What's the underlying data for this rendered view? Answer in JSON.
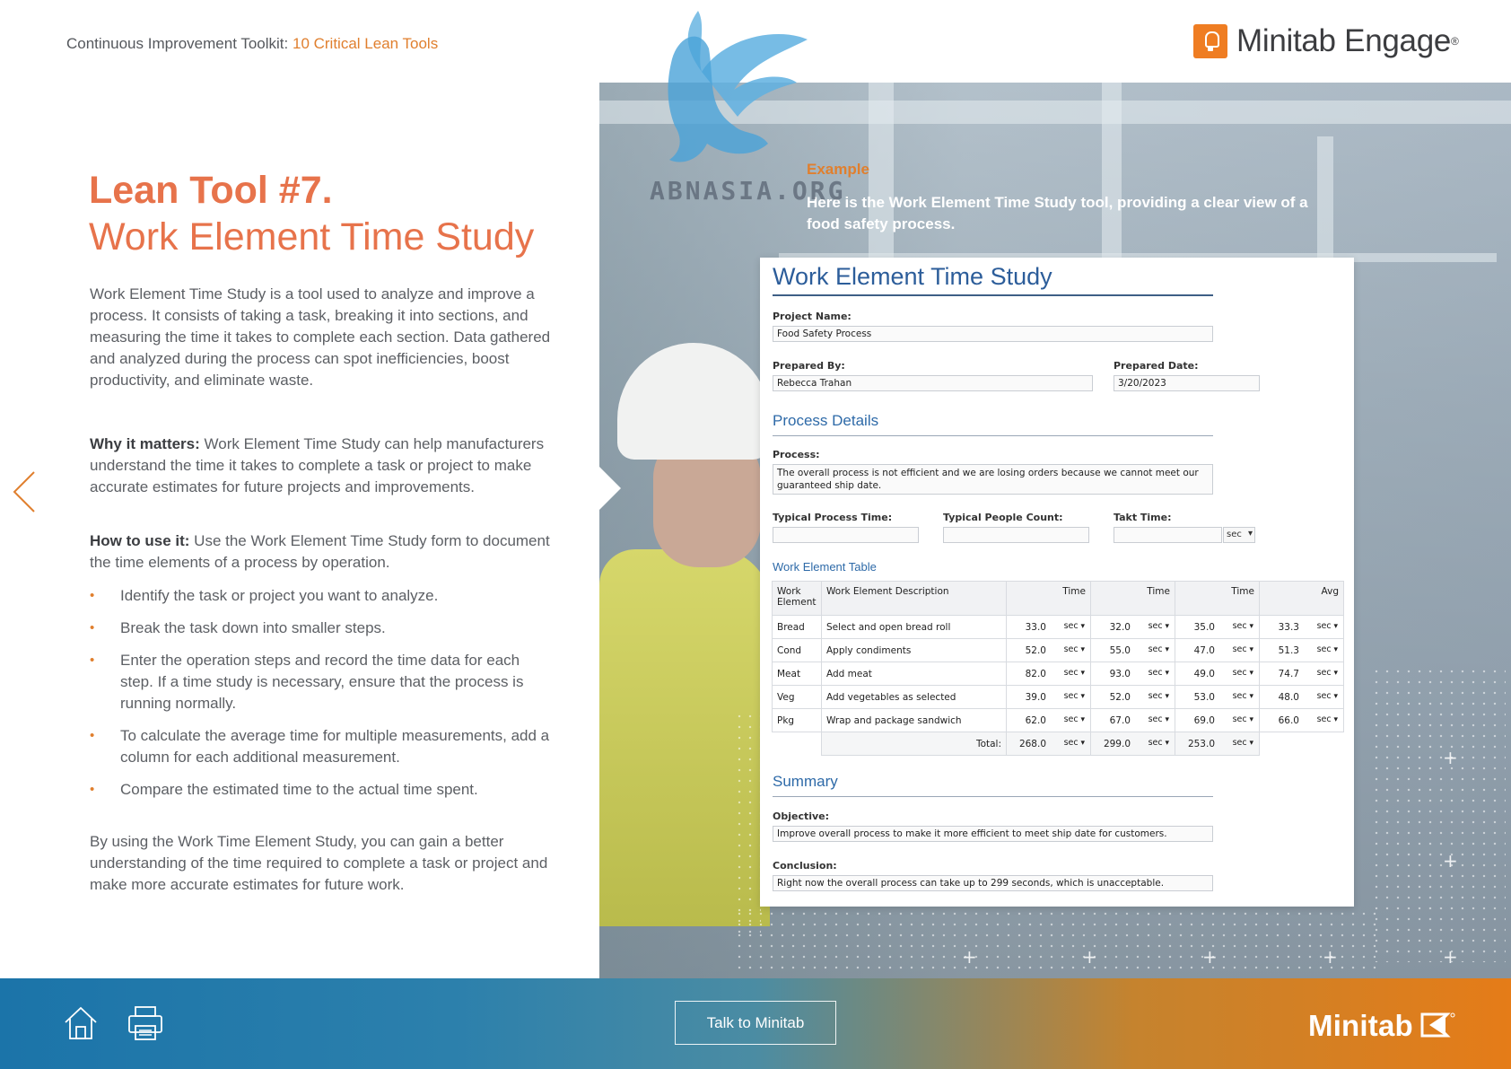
{
  "header": {
    "crumb_prefix": "Continuous Improvement Toolkit: ",
    "crumb_link": "10 Critical Lean Tools",
    "brand_name": "Minitab Engage",
    "brand_reg": "®"
  },
  "left": {
    "title_bold": "Lean Tool #7.",
    "title_light": "Work Element Time Study",
    "intro": "Work Element Time Study is a tool used to analyze and improve a process. It consists of taking a task, breaking it into sections, and measuring the time it takes to complete each section. Data gathered and analyzed during the process can spot inefficiencies, boost productivity, and eliminate waste.",
    "why_label": "Why it matters:",
    "why_text": " Work Element Time Study can help manufacturers understand the time it takes to complete a task or project to make accurate estimates for future projects and improvements.",
    "how_label": "How to use it:",
    "how_text": " Use the Work Element Time Study form to document the time elements of a process by operation.",
    "steps": [
      "Identify the task or project you want to analyze.",
      "Break the task down into smaller steps.",
      "Enter the operation steps and record the time data for each step. If a time study is necessary, ensure that the process is running normally.",
      "To calculate the average time for multiple measurements, add a column for each additional measurement.",
      "Compare the estimated time to the actual time spent."
    ],
    "closing": "By using the Work Time Element Study, you can gain a better understanding of the time required to complete a task or project and make more accurate estimates for future work."
  },
  "example": {
    "label": "Example",
    "text": "Here is the Work Element Time Study tool, providing a clear view of a food safety process."
  },
  "watermark": {
    "text": "ABNASIA.ORG"
  },
  "form": {
    "title": "Work Element Time Study",
    "project_name_label": "Project Name:",
    "project_name": "Food Safety Process",
    "prepared_by_label": "Prepared By:",
    "prepared_by": "Rebecca Trahan",
    "prepared_date_label": "Prepared Date:",
    "prepared_date": "3/20/2023",
    "process_details": "Process Details",
    "process_label": "Process:",
    "process_text": "The overall process is not efficient and we are losing orders because we cannot meet our guaranteed ship date.",
    "typical_time_label": "Typical Process Time:",
    "typical_people_label": "Typical People Count:",
    "takt_label": "Takt Time:",
    "takt_unit": "sec",
    "table_title": "Work Element Table",
    "columns": [
      "Work Element",
      "Work Element Description",
      "Time",
      "Time",
      "Time",
      "Avg"
    ],
    "rows": [
      {
        "element": "Bread",
        "desc": "Select and open bread roll",
        "t1": "33.0",
        "t2": "32.0",
        "t3": "35.0",
        "avg": "33.3"
      },
      {
        "element": "Cond",
        "desc": "Apply condiments",
        "t1": "52.0",
        "t2": "55.0",
        "t3": "47.0",
        "avg": "51.3"
      },
      {
        "element": "Meat",
        "desc": "Add meat",
        "t1": "82.0",
        "t2": "93.0",
        "t3": "49.0",
        "avg": "74.7"
      },
      {
        "element": "Veg",
        "desc": "Add vegetables as selected",
        "t1": "39.0",
        "t2": "52.0",
        "t3": "53.0",
        "avg": "48.0"
      },
      {
        "element": "Pkg",
        "desc": "Wrap and package sandwich",
        "t1": "62.0",
        "t2": "67.0",
        "t3": "69.0",
        "avg": "66.0"
      }
    ],
    "unit": "sec",
    "total_label": "Total:",
    "totals": [
      "268.0",
      "299.0",
      "253.0"
    ],
    "summary": "Summary",
    "objective_label": "Objective:",
    "objective": "Improve overall process to make it more efficient to meet ship date for customers.",
    "conclusion_label": "Conclusion:",
    "conclusion": "Right now the overall process can take up to 299 seconds, which is unacceptable."
  },
  "nav": {
    "prev_icon": "chevron-left-icon",
    "next_icon": "chevron-right-icon"
  },
  "footer": {
    "home_icon": "home-icon",
    "print_icon": "printer-icon",
    "cta": "Talk to Minitab",
    "logo": "Minitab"
  },
  "colors": {
    "accent_orange": "#e07f2e",
    "title_coral": "#e7734b",
    "form_blue": "#2c5d9a"
  }
}
